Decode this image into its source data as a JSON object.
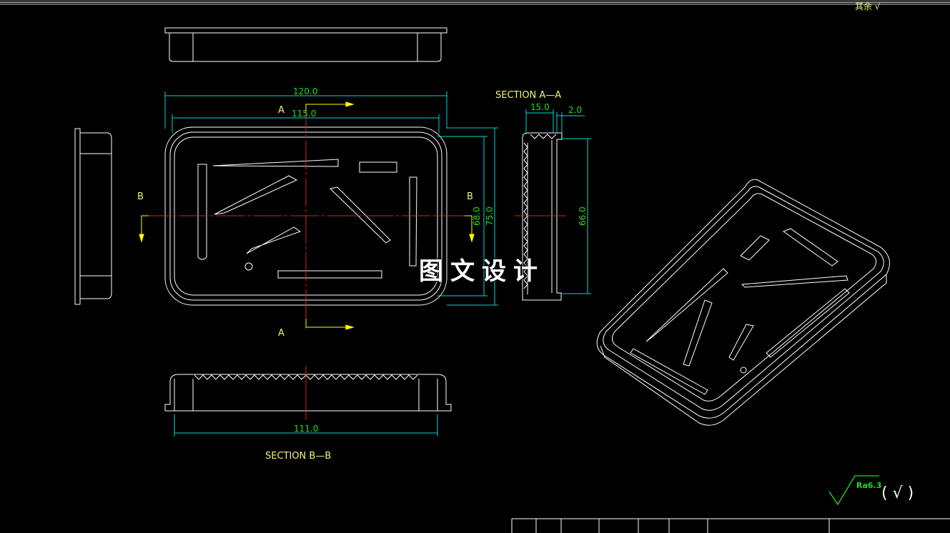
{
  "header": {
    "corner_text": "其余 √"
  },
  "labels": {
    "section_aa": "SECTION A—A",
    "section_bb": "SECTION B—B",
    "cut_a_top": "A",
    "cut_a_bottom": "A",
    "cut_b_left": "B",
    "cut_b_right": "B"
  },
  "dimensions": {
    "width_outer": "120.0",
    "width_inner": "115.0",
    "height_inner": "68.0",
    "height_outer": "75.0",
    "section_height": "66.0",
    "wall_depth": "15.0",
    "wall_thickness": "2.0",
    "section_width": "111.0"
  },
  "watermark": "图文设计",
  "roughness": {
    "value": "Ra6.3",
    "bracket": "( √ )"
  },
  "colors": {
    "line": "#ffffff",
    "dim": "#00d8d8",
    "text": "#f2f27a",
    "center": "#e02020",
    "arrow": "#ffff00",
    "green": "#22dd22"
  }
}
